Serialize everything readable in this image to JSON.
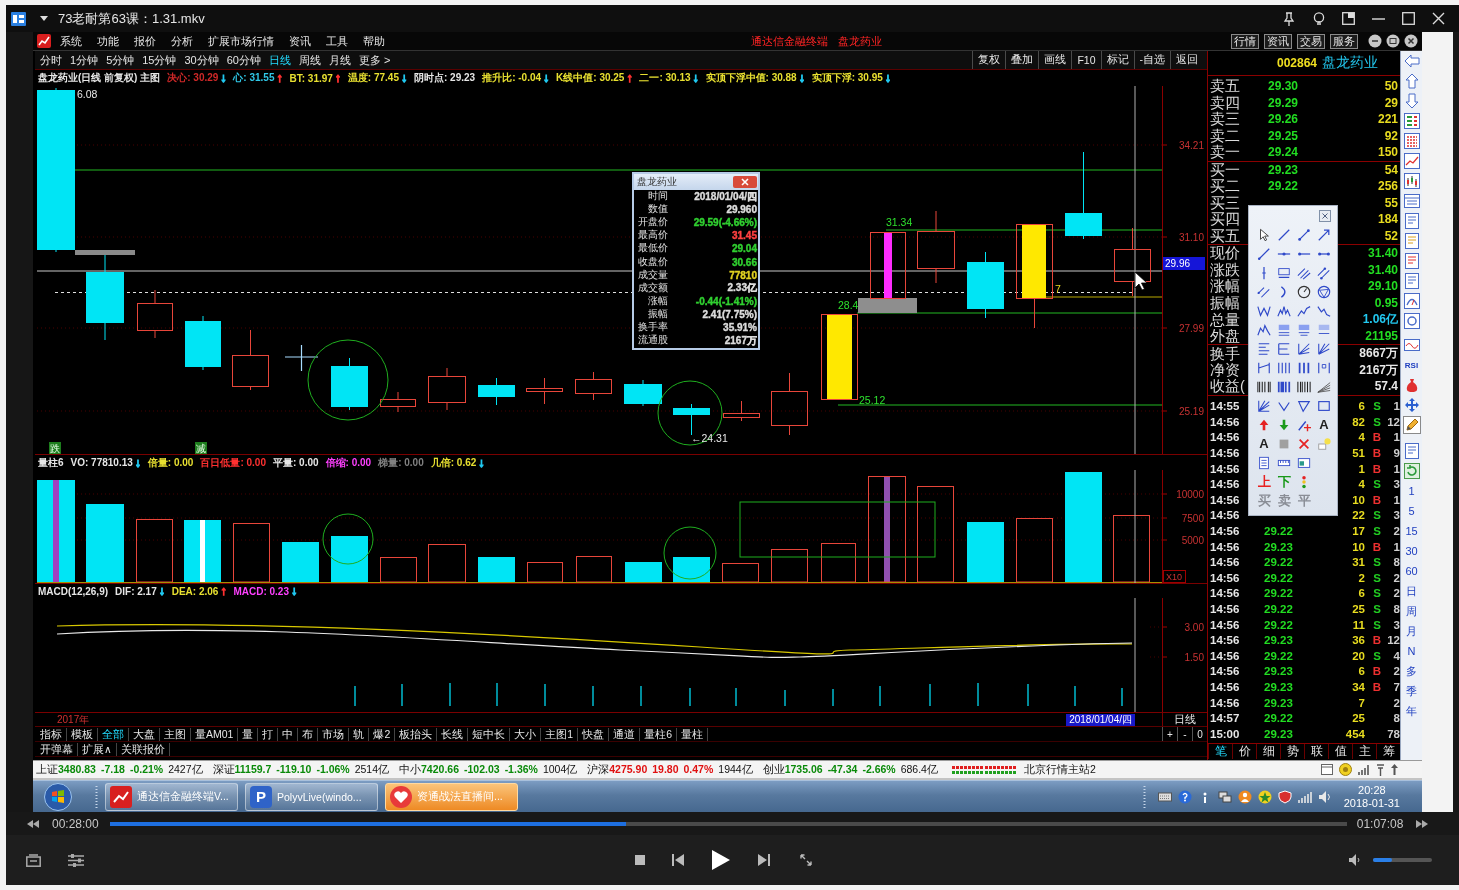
{
  "player": {
    "title": "73老耐第63课：1.31.mkv",
    "elapsed": "00:28:00",
    "duration": "01:07:08",
    "progress": {
      "level": 0.417
    },
    "volume": {
      "level": 0.33
    }
  },
  "app": {
    "menu": [
      "系统",
      "功能",
      "报价",
      "分析",
      "扩展市场行情",
      "资讯",
      "工具",
      "帮助"
    ],
    "caption": [
      "通达信金融终端",
      "盘龙药业"
    ],
    "service_buttons": [
      "行情",
      "资讯",
      "交易",
      "服务"
    ],
    "periods": [
      {
        "label": "分时",
        "selected": false
      },
      {
        "label": "1分钟",
        "selected": false
      },
      {
        "label": "5分钟",
        "selected": false
      },
      {
        "label": "15分钟",
        "selected": false
      },
      {
        "label": "30分钟",
        "selected": false
      },
      {
        "label": "60分钟",
        "selected": false
      },
      {
        "label": "日线",
        "selected": true
      },
      {
        "label": "周线",
        "selected": false
      },
      {
        "label": "月线",
        "selected": false
      },
      {
        "label": "更多 >",
        "selected": false
      }
    ],
    "chart_tools": [
      "复权",
      "叠加",
      "画线",
      "F10",
      "标记",
      "-自选",
      "返回"
    ],
    "main_chart": {
      "header": [
        {
          "text": "盘龙药业(日线 前复权) 主图",
          "color": "#e6e6e6"
        },
        {
          "text": "决心: 30.29",
          "color": "#d02828",
          "arrow": {
            "text": "↓",
            "color": "#20c8f0"
          }
        },
        {
          "text": "心: 31.55",
          "color": "#30c8e8",
          "arrow": {
            "text": "↑",
            "color": "#ff3030"
          }
        },
        {
          "text": "BT: 31.97",
          "color": "#e8e030",
          "arrow": {
            "text": "↑",
            "color": "#ff3030"
          }
        },
        {
          "text": "温度: 77.45",
          "color": "#e8e030",
          "arrow": {
            "text": "↓",
            "color": "#20c8f0"
          }
        },
        {
          "text": "阴时点: 29.23",
          "color": "#e6e6e6"
        },
        {
          "text": "推升比: -0.04",
          "color": "#e8e030",
          "arrow": {
            "text": "↓",
            "color": "#20c8f0"
          }
        },
        {
          "text": "K线中值: 30.25",
          "color": "#e8e030",
          "arrow": {
            "text": "↑",
            "color": "#ff3030"
          }
        },
        {
          "text": "二一: 30.13",
          "color": "#e8e030",
          "arrow": {
            "text": "↓",
            "color": "#20c8f0"
          }
        },
        {
          "text": "实顶下浮中值: 30.88",
          "color": "#e8e030",
          "arrow": {
            "text": "↓",
            "color": "#20c8f0"
          }
        },
        {
          "text": "实顶下浮: 30.95",
          "color": "#e8e030",
          "arrow": {
            "text": "↓",
            "color": "#20c8f0"
          }
        }
      ],
      "axis_labels": [
        "34.21",
        "31.10",
        "27.99",
        "25.19"
      ],
      "cursor_price": "29.96",
      "price_labels": [
        "6.08",
        "31.34",
        "28.4",
        "25.12",
        "←24.31",
        "7"
      ],
      "signals": [
        "跌",
        "减"
      ],
      "info_window": {
        "title": "盘龙药业",
        "rows": [
          {
            "label": "时间",
            "value": "2018/01/04/四"
          },
          {
            "label": "数值",
            "value": "29.960"
          },
          {
            "label": "开盘价",
            "value": "29.59(-4.66%)",
            "color": "#30d030"
          },
          {
            "label": "最高价",
            "value": "31.45",
            "color": "#ff4040"
          },
          {
            "label": "最低价",
            "value": "29.04",
            "color": "#30d030"
          },
          {
            "label": "收盘价",
            "value": "30.66",
            "color": "#30d030"
          },
          {
            "label": "成交量",
            "value": "77810",
            "color": "#e0d020"
          },
          {
            "label": "成交额",
            "value": "2.33亿"
          },
          {
            "label": "涨幅",
            "value": "-0.44(-1.41%)",
            "color": "#30d030"
          },
          {
            "label": "振幅",
            "value": "2.41(7.75%)"
          },
          {
            "label": "换手率",
            "value": "35.91%"
          },
          {
            "label": "流通股",
            "value": "2167万"
          }
        ]
      }
    },
    "volume_chart": {
      "header": [
        {
          "text": "量柱6",
          "color": "#e6e6e6"
        },
        {
          "text": "VO: 77810.13",
          "color": "#e6e6e6",
          "arrow": {
            "text": "↓",
            "color": "#20c8f0"
          }
        },
        {
          "text": "倍量: 0.00",
          "color": "#e8e030"
        },
        {
          "text": "百日低量: 0.00",
          "color": "#ff3030"
        },
        {
          "text": "平量: 0.00",
          "color": "#e6e6e6"
        },
        {
          "text": "倍缩: 0.00",
          "color": "#ff40ff"
        },
        {
          "text": "梯量: 0.00",
          "color": "#808080"
        },
        {
          "text": "几倍: 0.62",
          "color": "#e8e030",
          "arrow": {
            "text": "↓",
            "color": "#20c8f0"
          }
        }
      ],
      "axis_labels": [
        "10000",
        "7500",
        "5000"
      ],
      "scale": "X10"
    },
    "macd_chart": {
      "header": [
        {
          "text": "MACD(12,26,9)",
          "color": "#e6e6e6"
        },
        {
          "text": "DIF: 2.17",
          "color": "#e6e6e6",
          "arrow": {
            "text": "↓",
            "color": "#20c8f0"
          }
        },
        {
          "text": "DEA: 2.06",
          "color": "#e8e030",
          "arrow": {
            "text": "↑",
            "color": "#ff3030"
          }
        },
        {
          "text": "MACD: 0.23",
          "color": "#ff40ff",
          "arrow": {
            "text": "↓",
            "color": "#20c8f0"
          }
        }
      ],
      "axis_labels": [
        "3.00",
        "1.50"
      ]
    },
    "timeline": {
      "year": "2017年",
      "cursor_date": "2018/01/04/四",
      "period": "日线"
    },
    "zoom_buttons": [
      "+",
      "-",
      "0"
    ],
    "indicator_tabs": [
      {
        "label": "指标",
        "selected": false
      },
      {
        "label": "模板",
        "selected": false
      },
      {
        "label": "全部",
        "selected": true
      },
      {
        "label": "大盘",
        "selected": false
      },
      {
        "label": "主图",
        "selected": false
      },
      {
        "label": "量AM01",
        "selected": false
      },
      {
        "label": "量",
        "selected": false
      },
      {
        "label": "打",
        "selected": false
      },
      {
        "label": "中",
        "selected": false
      },
      {
        "label": "布",
        "selected": false
      },
      {
        "label": "市场",
        "selected": false
      },
      {
        "label": "轨",
        "selected": false
      },
      {
        "label": "爆2",
        "selected": false
      },
      {
        "label": "板抬头",
        "selected": false
      },
      {
        "label": "长线",
        "selected": false
      },
      {
        "label": "短中长",
        "selected": false
      },
      {
        "label": "大小",
        "selected": false
      },
      {
        "label": "主图1",
        "selected": false
      },
      {
        "label": "快盘",
        "selected": false
      },
      {
        "label": "通道",
        "selected": false
      },
      {
        "label": "量柱6",
        "selected": false
      },
      {
        "label": "量柱",
        "selected": false
      }
    ],
    "extra_tabs": [
      "开弹幕",
      "扩展∧",
      "关联报价"
    ],
    "quote": {
      "code": "002864",
      "name": "盘龙药业",
      "asks": [
        {
          "label": "卖五",
          "price": "29.30",
          "volume": "50"
        },
        {
          "label": "卖四",
          "price": "29.29",
          "volume": "29"
        },
        {
          "label": "卖三",
          "price": "29.26",
          "volume": "221"
        },
        {
          "label": "卖二",
          "price": "29.25",
          "volume": "92"
        },
        {
          "label": "卖一",
          "price": "29.24",
          "volume": "150"
        }
      ],
      "bids": [
        {
          "label": "买一",
          "price": "29.23",
          "volume": "54"
        },
        {
          "label": "买二",
          "price": "29.22",
          "volume": "256"
        },
        {
          "label": "买三",
          "volume": "55"
        },
        {
          "label": "买四",
          "volume": "184"
        },
        {
          "label": "买五",
          "volume": "52"
        }
      ],
      "stats": [
        {
          "label": "现价",
          "value": "31.40",
          "color": "#22dd22"
        },
        {
          "label": "涨跌",
          "value": "31.40",
          "color": "#22dd22"
        },
        {
          "label": "涨幅",
          "value": "29.10",
          "color": "#22dd22"
        },
        {
          "label": "振幅",
          "value": "0.95",
          "color": "#22dd22"
        },
        {
          "label": "总量",
          "value": "1.06亿",
          "color": "#22c8f0"
        },
        {
          "label": "外盘",
          "value": "21195",
          "color": "#22dd22"
        }
      ],
      "stats2": [
        {
          "label": "换手",
          "value": "8667万"
        },
        {
          "label": "净资",
          "value": "2167万"
        },
        {
          "label": "收益(",
          "value": "57.4"
        }
      ],
      "trades": [
        {
          "time": "14:55",
          "volume": "6",
          "flag": "S",
          "kind": "sell",
          "count": "1"
        },
        {
          "time": "14:56",
          "volume": "82",
          "flag": "S",
          "kind": "sell",
          "count": "12"
        },
        {
          "time": "14:56",
          "volume": "4",
          "flag": "B",
          "kind": "buy",
          "count": "1"
        },
        {
          "time": "14:56",
          "volume": "51",
          "flag": "B",
          "kind": "buy",
          "count": "9"
        },
        {
          "time": "14:56",
          "volume": "1",
          "flag": "B",
          "kind": "buy",
          "count": "1"
        },
        {
          "time": "14:56",
          "volume": "4",
          "flag": "S",
          "kind": "sell",
          "count": "3"
        },
        {
          "time": "14:56",
          "volume": "10",
          "flag": "B",
          "kind": "buy",
          "count": "1"
        },
        {
          "time": "14:56",
          "volume": "22",
          "flag": "S",
          "kind": "sell",
          "count": "3"
        },
        {
          "time": "14:56",
          "price": "29.22",
          "volume": "17",
          "flag": "S",
          "kind": "sell",
          "count": "2"
        },
        {
          "time": "14:56",
          "price": "29.23",
          "volume": "10",
          "flag": "B",
          "kind": "buy",
          "count": "1"
        },
        {
          "time": "14:56",
          "price": "29.22",
          "volume": "31",
          "flag": "S",
          "kind": "sell",
          "count": "8"
        },
        {
          "time": "14:56",
          "price": "29.22",
          "volume": "2",
          "flag": "S",
          "kind": "sell",
          "count": "2"
        },
        {
          "time": "14:56",
          "price": "29.22",
          "volume": "6",
          "flag": "S",
          "kind": "sell",
          "count": "2"
        },
        {
          "time": "14:56",
          "price": "29.22",
          "volume": "25",
          "flag": "S",
          "kind": "sell",
          "count": "8"
        },
        {
          "time": "14:56",
          "price": "29.22",
          "volume": "11",
          "flag": "S",
          "kind": "sell",
          "count": "3"
        },
        {
          "time": "14:56",
          "price": "29.23",
          "volume": "36",
          "flag": "B",
          "kind": "buy",
          "count": "12"
        },
        {
          "time": "14:56",
          "price": "29.22",
          "volume": "20",
          "flag": "S",
          "kind": "sell",
          "count": "4"
        },
        {
          "time": "14:56",
          "price": "29.23",
          "volume": "6",
          "flag": "B",
          "kind": "buy",
          "count": "2"
        },
        {
          "time": "14:56",
          "price": "29.23",
          "volume": "34",
          "flag": "B",
          "kind": "buy",
          "count": "7"
        },
        {
          "time": "14:56",
          "price": "29.23",
          "volume": "7",
          "count": "2"
        },
        {
          "time": "14:57",
          "price": "29.22",
          "volume": "25",
          "count": "8"
        },
        {
          "time": "15:00",
          "price": "29.23",
          "volume": "454",
          "count": "78"
        }
      ],
      "detail_tabs": [
        {
          "label": "笔",
          "selected": true
        },
        {
          "label": "价",
          "selected": false
        },
        {
          "label": "细",
          "selected": false
        },
        {
          "label": "势",
          "selected": false
        },
        {
          "label": "联",
          "selected": false
        },
        {
          "label": "值",
          "selected": false
        },
        {
          "label": "主",
          "selected": false
        },
        {
          "label": "筹",
          "selected": false
        }
      ]
    },
    "drawing_palette": {
      "text_tools": [
        "A",
        "A"
      ],
      "order_marks": [
        {
          "label": "上",
          "color": "#e82020",
          "disabled": false
        },
        {
          "label": "下",
          "color": "#189818",
          "disabled": false
        },
        {
          "label": "买",
          "disabled": true
        },
        {
          "label": "卖",
          "disabled": true
        },
        {
          "label": "平",
          "disabled": true
        }
      ]
    },
    "side_toolbar": {
      "indicator": "RSI",
      "draw_mode": true,
      "periods": [
        "1",
        "5",
        "15",
        "30",
        "60",
        "日",
        "周",
        "月",
        "N",
        "多",
        "季",
        "年"
      ]
    },
    "status_bar": {
      "indices": [
        {
          "name": "上证",
          "value": "3480.83",
          "change": "-7.18",
          "percent": "-0.21%",
          "amount": "2427亿",
          "color": "#0a8a0a"
        },
        {
          "name": "深证",
          "value": "11159.7",
          "change": "-119.10",
          "percent": "-1.06%",
          "amount": "2514亿",
          "color": "#0a8a0a"
        },
        {
          "name": "中小",
          "value": "7420.66",
          "change": "-102.03",
          "percent": "-1.36%",
          "amount": "1004亿",
          "color": "#0a8a0a"
        },
        {
          "name": "沪深",
          "value": "4275.90",
          "change": "19.80",
          "percent": "0.47%",
          "amount": "1944亿",
          "color": "#e01010"
        },
        {
          "name": "创业",
          "value": "1735.06",
          "change": "-47.34",
          "percent": "-2.66%",
          "amount": "686.4亿",
          "color": "#0a8a0a"
        }
      ],
      "server": "北京行情主站2"
    }
  },
  "taskbar": {
    "apps": [
      {
        "label": "通达信金融终端V...",
        "kind": "chart",
        "highlighted": false
      },
      {
        "label": "PolyvLive(windo...",
        "kind": "letter",
        "badge": "P",
        "highlighted": false
      },
      {
        "label": "资通战法直播间...",
        "kind": "heart",
        "highlighted": true
      }
    ],
    "clock": {
      "time": "20:28",
      "date": "2018-01-31"
    }
  }
}
